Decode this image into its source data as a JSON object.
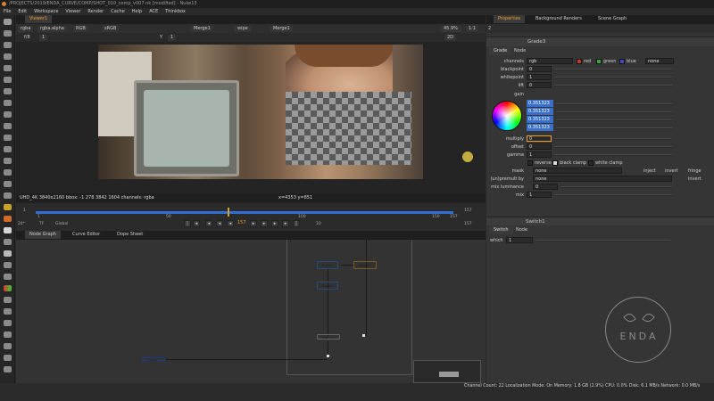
{
  "window": {
    "title": "/PROJECTS/2019/ENDA_CURVE/COMP/SHOT_010_comp_v007.nk [modified] - Nuke13"
  },
  "menu": [
    "File",
    "Edit",
    "Workspace",
    "Viewer",
    "Render",
    "Cache",
    "Help",
    "ACE",
    "Thinkbox"
  ],
  "viewer": {
    "tab": "Viewer1",
    "channels": "rgba",
    "alpha": "rgba.alpha",
    "colorspace_a": "RGB",
    "lut": "sRGB",
    "input_a": "Merge1",
    "wipe": "wipe",
    "input_b": "Merge1",
    "frame_label": "f/8",
    "frame_value": "1",
    "y_label": "Y",
    "y_value": "1",
    "zoom": "45.9%",
    "ratio": "1:1",
    "view": "2D",
    "info": "UHD_4K 3840x2160  bbox: -1 278 3842 1604 channels: rgba",
    "coords": "x=4353 y=851"
  },
  "timeline": {
    "start": "1",
    "end": "157",
    "mid": "90",
    "ticks": [
      "1",
      "50",
      "100",
      "150",
      "157"
    ],
    "fps": "24*",
    "tf": "TF",
    "range": "Global",
    "frame": "157",
    "skip": "10",
    "in": "1",
    "out": "157"
  },
  "nodegraph": {
    "tabs": [
      "Node Graph",
      "Curve Editor",
      "Dope Sheet"
    ],
    "nodes": [
      {
        "label": "Grade1",
        "color": "#8fa6c8"
      },
      {
        "label": "Merge1",
        "color": "#e0b060"
      },
      {
        "label": "Grade2",
        "color": "#8fa6c8"
      },
      {
        "label": "Switch1",
        "color": "#d0d0d0"
      },
      {
        "label": "Read1",
        "color": "#3a6fd6"
      }
    ]
  },
  "properties": {
    "tabs": [
      "Properties",
      "Background Renders",
      "Scene Graph"
    ],
    "count": "2",
    "node_name": "Grade3",
    "subtabs": [
      "Grade",
      "Node"
    ],
    "channels_label": "channels",
    "channels_value": "rgb",
    "ch_red": "red",
    "ch_green": "green",
    "ch_blue": "blue",
    "ch_none": "none",
    "knobs": [
      {
        "label": "blackpoint",
        "value": "0"
      },
      {
        "label": "whitepoint",
        "value": "1"
      },
      {
        "label": "lift",
        "value": "0"
      },
      {
        "label": "gain",
        "value": ""
      }
    ],
    "gain_values": [
      "0.351323",
      "0.351323",
      "0.351323",
      "0.351323"
    ],
    "knobs2": [
      {
        "label": "multiply",
        "value": "0"
      },
      {
        "label": "offset",
        "value": "0"
      },
      {
        "label": "gamma",
        "value": "1"
      }
    ],
    "checks": [
      "reverse",
      "black clamp",
      "white clamp"
    ],
    "mask_label": "mask",
    "mask_value": "none",
    "inject": "inject",
    "invert": "invert",
    "fringe": "fringe",
    "premult_label": "(un)premult by",
    "premult_value": "none",
    "invert2": "invert",
    "mixlum_label": "mix luminance",
    "mixlum_value": "0",
    "mix_label": "mix",
    "mix_value": "1",
    "p2_name": "Switch1",
    "p2_tabs": [
      "Switch",
      "Node"
    ],
    "which_label": "which",
    "which_value": "1"
  },
  "watermark": "ENDA",
  "status": "Channel Count: 22  Localization Mode: On  Memory: 1.8 GB (2.9%)  CPU: 0.0%  Disk: 6.1 MB/s  Network: 0.0 MB/s",
  "colors": {
    "accent": "#f0a030",
    "selection": "#3a6fc9",
    "timeline": "#2f6fd6"
  }
}
